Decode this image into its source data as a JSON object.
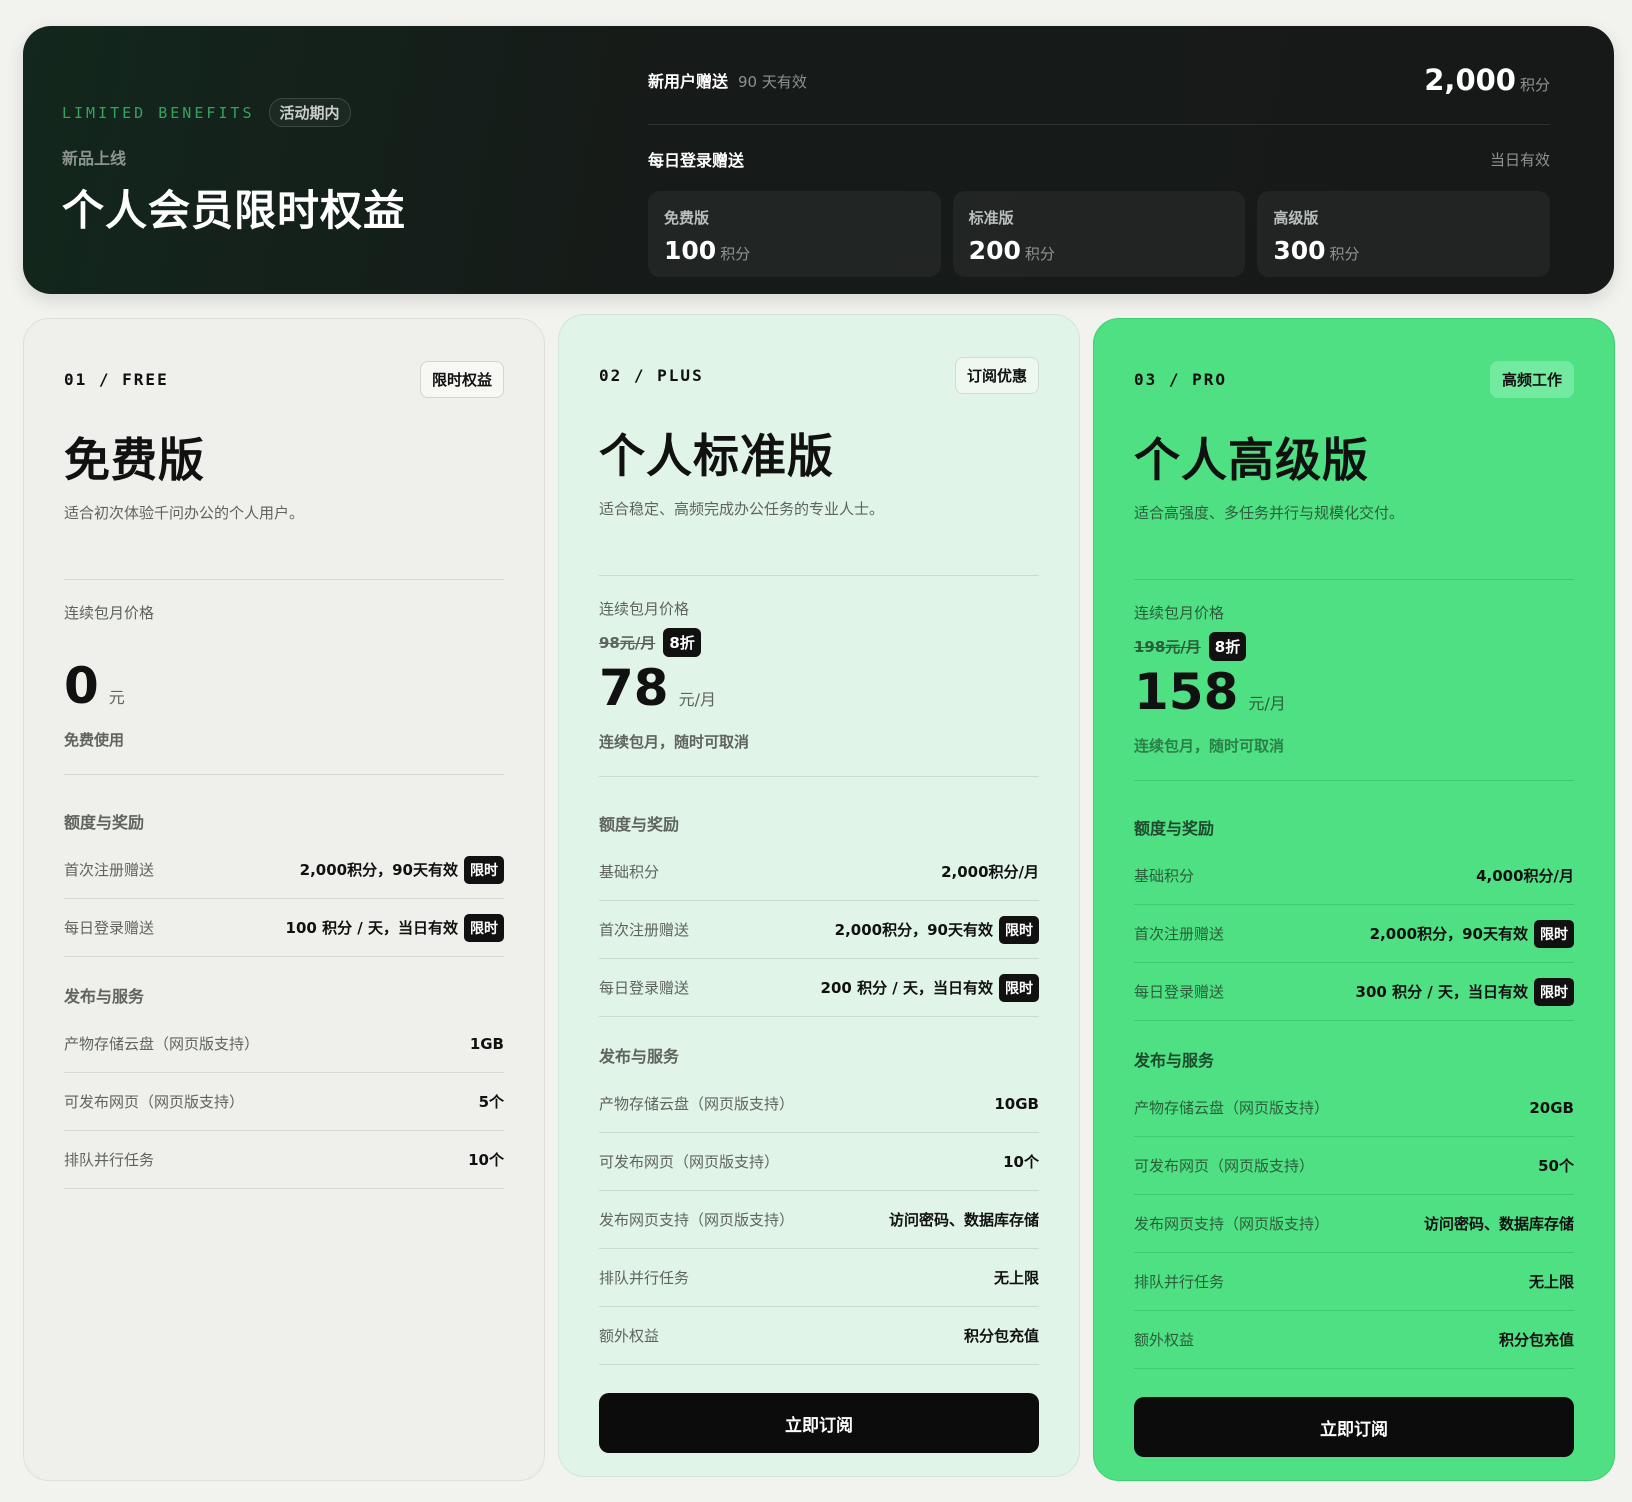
{
  "banner": {
    "eyebrow": "LIMITED BENEFITS",
    "pill": "活动期内",
    "subtitle": "新品上线",
    "title": "个人会员限时权益",
    "new_user": {
      "label": "新用户赠送",
      "note": "90 天有效",
      "value": "2,000",
      "unit": "积分"
    },
    "daily": {
      "label": "每日登录赠送",
      "note": "当日有效"
    },
    "tiers": [
      {
        "name": "免费版",
        "value": "100",
        "unit": "积分"
      },
      {
        "name": "标准版",
        "value": "200",
        "unit": "积分"
      },
      {
        "name": "高级版",
        "value": "300",
        "unit": "积分"
      }
    ]
  },
  "plans": [
    {
      "code": "01 / FREE",
      "tag": "限时权益",
      "name": "免费版",
      "desc": "适合初次体验千问办公的个人用户。",
      "price_label": "连续包月价格",
      "price": "0",
      "price_unit": "元",
      "price_note": "免费使用",
      "quota_title": "额度与奖励",
      "quota": [
        {
          "label": "首次注册赠送",
          "value": "2,000积分，90天有效",
          "limit": "限时"
        },
        {
          "label": "每日登录赠送",
          "value": "100 积分 / 天，当日有效",
          "limit": "限时"
        }
      ],
      "service_title": "发布与服务",
      "services": [
        {
          "label": "产物存储云盘（网页版支持）",
          "value": "1GB"
        },
        {
          "label": "可发布网页（网页版支持）",
          "value": "5个"
        },
        {
          "label": "排队并行任务",
          "value": "10个"
        }
      ]
    },
    {
      "code": "02 / PLUS",
      "tag": "订阅优惠",
      "name": "个人标准版",
      "desc": "适合稳定、高频完成办公任务的专业人士。",
      "price_label": "连续包月价格",
      "orig_price": "98元/月",
      "discount": "8折",
      "price": "78",
      "price_unit": "元/月",
      "price_note": "连续包月，随时可取消",
      "quota_title": "额度与奖励",
      "quota": [
        {
          "label": "基础积分",
          "value": "2,000积分/月"
        },
        {
          "label": "首次注册赠送",
          "value": "2,000积分，90天有效",
          "limit": "限时"
        },
        {
          "label": "每日登录赠送",
          "value": "200 积分 / 天，当日有效",
          "limit": "限时"
        }
      ],
      "service_title": "发布与服务",
      "services": [
        {
          "label": "产物存储云盘（网页版支持）",
          "value": "10GB"
        },
        {
          "label": "可发布网页（网页版支持）",
          "value": "10个"
        },
        {
          "label": "发布网页支持（网页版支持）",
          "value": "访问密码、数据库存储"
        },
        {
          "label": "排队并行任务",
          "value": "无上限"
        },
        {
          "label": "额外权益",
          "value": "积分包充值"
        }
      ],
      "cta": "立即订阅"
    },
    {
      "code": "03 / PRO",
      "tag": "高频工作",
      "name": "个人高级版",
      "desc": "适合高强度、多任务并行与规模化交付。",
      "price_label": "连续包月价格",
      "orig_price": "198元/月",
      "discount": "8折",
      "price": "158",
      "price_unit": "元/月",
      "price_note": "连续包月，随时可取消",
      "quota_title": "额度与奖励",
      "quota": [
        {
          "label": "基础积分",
          "value": "4,000积分/月"
        },
        {
          "label": "首次注册赠送",
          "value": "2,000积分，90天有效",
          "limit": "限时"
        },
        {
          "label": "每日登录赠送",
          "value": "300 积分 / 天，当日有效",
          "limit": "限时"
        }
      ],
      "service_title": "发布与服务",
      "services": [
        {
          "label": "产物存储云盘（网页版支持）",
          "value": "20GB"
        },
        {
          "label": "可发布网页（网页版支持）",
          "value": "50个"
        },
        {
          "label": "发布网页支持（网页版支持）",
          "value": "访问密码、数据库存储"
        },
        {
          "label": "排队并行任务",
          "value": "无上限"
        },
        {
          "label": "额外权益",
          "value": "积分包充值"
        }
      ],
      "cta": "立即订阅"
    }
  ]
}
